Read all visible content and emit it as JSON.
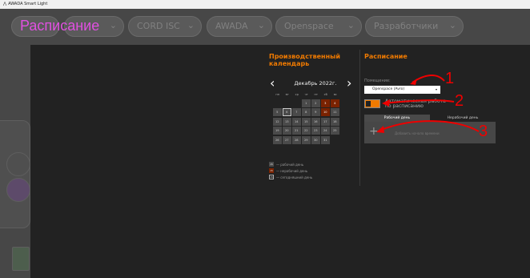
{
  "window": {
    "title": "AWADA Smart Light"
  },
  "background": {
    "page_title": "Расписание",
    "pills": [
      "",
      "",
      "CORD ISC",
      "AWADA",
      "Openspace",
      "Разработчики"
    ]
  },
  "calendar": {
    "title": "Производственный календарь",
    "month_label": "Декабрь 2022г.",
    "prev_icon": "‹",
    "next_icon": "›",
    "weekdays": [
      "пн",
      "вт",
      "ср",
      "чт",
      "пт",
      "сб",
      "вс"
    ],
    "weeks": [
      [
        "",
        "",
        "",
        "1",
        "2",
        "3",
        "4"
      ],
      [
        "5",
        "6",
        "7",
        "8",
        "9",
        "10",
        "11"
      ],
      [
        "12",
        "13",
        "14",
        "15",
        "16",
        "17",
        "18"
      ],
      [
        "19",
        "20",
        "21",
        "22",
        "23",
        "24",
        "25"
      ],
      [
        "26",
        "27",
        "28",
        "29",
        "30",
        "31",
        ""
      ]
    ],
    "holidays": [
      "3",
      "4",
      "10"
    ],
    "today": "6",
    "legend": [
      {
        "sample": "15",
        "text": "— рабочий день"
      },
      {
        "sample": "15",
        "text": "— нерабочий день"
      },
      {
        "sample": "15",
        "text": "— сегодняшний день"
      }
    ]
  },
  "schedule": {
    "title": "Расписание",
    "room_label": "Помещение:",
    "room_value": "Openspace (Avro)",
    "auto_label": "Автоматическая работа по расписанию",
    "tabs": [
      "Рабочий день",
      "Нерабочий день"
    ],
    "add_icon": "+",
    "add_text": "Добавить начало времени"
  },
  "annotations": [
    "1",
    "2",
    "3"
  ],
  "colors": {
    "accent": "#f07a00",
    "holiday": "#7a2200",
    "annotation": "#ee0000",
    "title_magenta": "#e050e0"
  }
}
